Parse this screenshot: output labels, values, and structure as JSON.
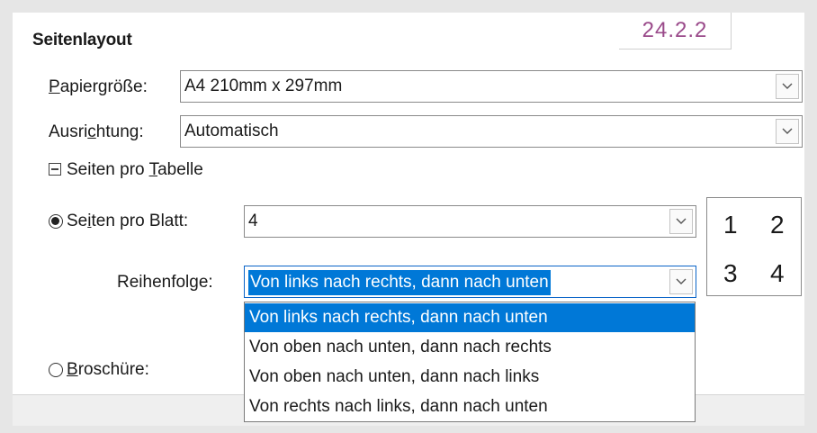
{
  "version": "24.2.2",
  "section": {
    "title": "Seitenlayout"
  },
  "paper_size": {
    "label_pre": "",
    "label_mnemonic": "P",
    "label_post": "apiergröße:",
    "value": "A4 210mm x 297mm"
  },
  "orientation": {
    "label_pre": "Ausri",
    "label_mnemonic": "c",
    "label_post": "htung:",
    "value": "Automatisch"
  },
  "pages_per_sheet_group": {
    "label_pre": "Seiten pro ",
    "label_mnemonic": "T",
    "label_post": "abelle"
  },
  "pages_per_sheet": {
    "label_pre": "Se",
    "label_mnemonic": "i",
    "label_post": "ten pro Blatt:",
    "value": "4",
    "checked": true
  },
  "order": {
    "label_pre": "Reihenfol",
    "label_mnemonic": "g",
    "label_post": "e:",
    "value": "Von links nach rechts, dann nach unten",
    "options": [
      "Von links nach rechts, dann nach unten",
      "Von oben nach unten, dann nach rechts",
      "Von oben nach unten, dann nach links",
      "Von rechts nach links, dann nach unten"
    ],
    "selected_index": 0
  },
  "brochure": {
    "label_pre": "",
    "label_mnemonic": "B",
    "label_post": "roschüre:",
    "checked": false
  },
  "preview": {
    "numbers": [
      "1",
      "2",
      "3",
      "4"
    ]
  },
  "icons": {
    "dropdown": "chevron-down-icon",
    "expander": "collapse-minus-icon",
    "radio": "radio-button-icon"
  },
  "colors": {
    "accent": "#0078d7",
    "version_text": "#9a4a8a"
  }
}
